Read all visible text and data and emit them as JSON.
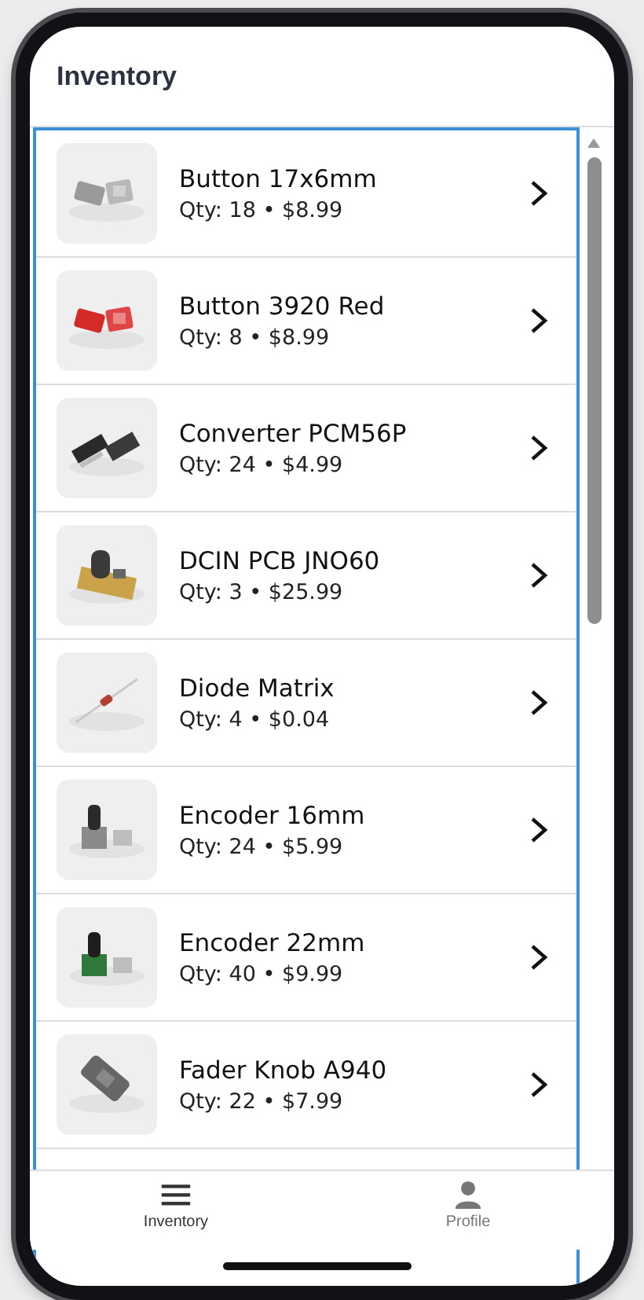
{
  "header": {
    "title": "Inventory"
  },
  "items": [
    {
      "name": "Button 17x6mm",
      "details": "Qty: 18 • $8.99"
    },
    {
      "name": "Button 3920 Red",
      "details": "Qty: 8 • $8.99"
    },
    {
      "name": "Converter PCM56P",
      "details": "Qty: 24 • $4.99"
    },
    {
      "name": "DCIN PCB JNO60",
      "details": "Qty: 3 • $25.99"
    },
    {
      "name": "Diode Matrix",
      "details": "Qty: 4 • $0.04"
    },
    {
      "name": "Encoder 16mm",
      "details": "Qty: 24 • $5.99"
    },
    {
      "name": "Encoder 22mm",
      "details": "Qty: 40 • $9.99"
    },
    {
      "name": "Fader Knob A940",
      "details": "Qty: 22 • $7.99"
    }
  ],
  "tabs": [
    {
      "label": "Inventory",
      "selected": true
    },
    {
      "label": "Profile",
      "selected": false
    }
  ]
}
